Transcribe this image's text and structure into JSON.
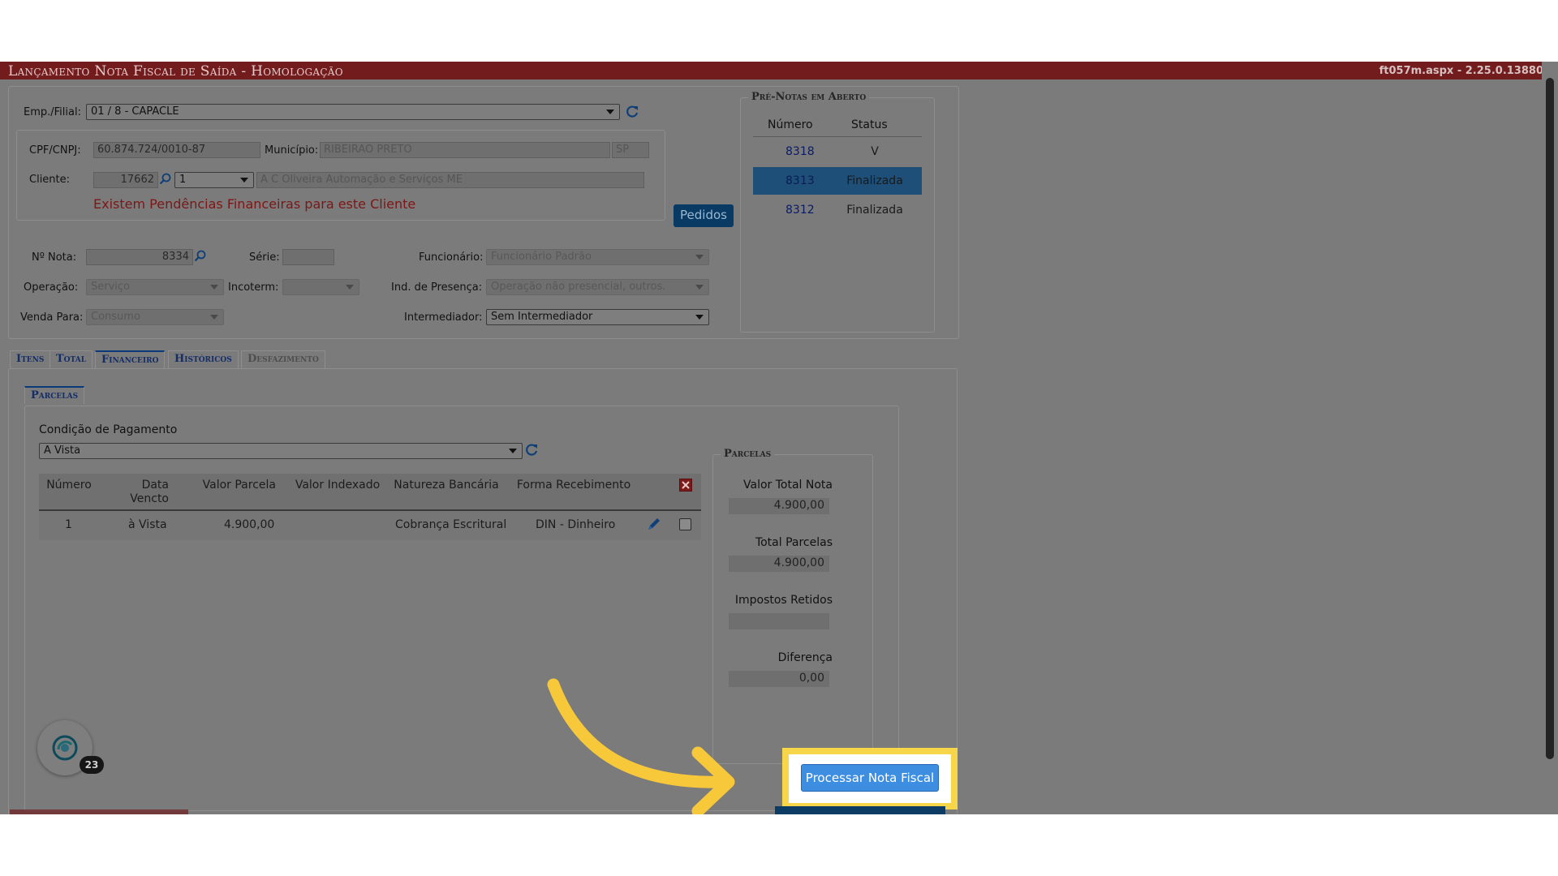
{
  "window": {
    "title": "Lançamento Nota Fiscal de Saída  - Homologação",
    "version": "ft057m.aspx - 2.25.0.13880"
  },
  "header": {
    "emp_label": "Emp./Filial:",
    "emp_value": "01 / 8 - CAPACLE",
    "cpf_label": "CPF/CNPJ:",
    "cpf_value": "60.874.724/0010-87",
    "municipio_label": "Município:",
    "municipio_value": "RIBEIRAO PRETO",
    "uf_value": "SP",
    "cliente_label": "Cliente:",
    "cliente_code": "17662",
    "cliente_seq": "1",
    "cliente_name": "A C Oliveira Automação e Serviços ME",
    "warning": "Existem Pendências Financeiras para este Cliente",
    "pedidos_button": "Pedidos"
  },
  "note": {
    "nota_label": "Nº Nota:",
    "nota_value": "8334",
    "serie_label": "Série:",
    "serie_value": "",
    "funcionario_label": "Funcionário:",
    "funcionario_value": "Funcionário Padrão",
    "operacao_label": "Operação:",
    "operacao_value": "Serviço",
    "incoterm_label": "Incoterm:",
    "incoterm_value": "",
    "presenca_label": "Ind. de Presença:",
    "presenca_value": "Operação não presencial, outros.",
    "venda_label": "Venda Para:",
    "venda_value": "Consumo",
    "intermediador_label": "Intermediador:",
    "intermediador_value": "Sem Intermediador"
  },
  "pre_notas": {
    "legend": "Pré-Notas em Aberto",
    "col_numero": "Número",
    "col_status": "Status",
    "rows": [
      {
        "numero": "8318",
        "status": "V"
      },
      {
        "numero": "8313",
        "status": "Finalizada"
      },
      {
        "numero": "8312",
        "status": "Finalizada"
      }
    ]
  },
  "tabs": [
    "Itens",
    "Total",
    "Financeiro",
    "Históricos",
    "Desfazimento"
  ],
  "financeiro": {
    "subtab": "Parcelas",
    "cond_label": "Condição de Pagamento",
    "cond_value": "A Vista",
    "columns": [
      "Número",
      "Data Vencto",
      "Valor Parcela",
      "Valor Indexado",
      "Natureza Bancária",
      "Forma Recebimento"
    ],
    "rows": [
      {
        "numero": "1",
        "vencto": "à Vista",
        "valor": "4.900,00",
        "indexado": "",
        "natureza": "Cobrança Escritural",
        "forma": "DIN - Dinheiro"
      }
    ]
  },
  "parcelas_summary": {
    "legend": "Parcelas",
    "valor_total_label": "Valor Total Nota",
    "valor_total": "4.900,00",
    "total_parcelas_label": "Total Parcelas",
    "total_parcelas": "4.900,00",
    "impostos_label": "Impostos Retidos",
    "impostos": "",
    "diferenca_label": "Diferença",
    "diferenca": "0,00"
  },
  "actions": {
    "processar": "Processar Nota Fiscal"
  },
  "chat_badge": "23",
  "colors": {
    "titlebar": "#731c1e",
    "highlight": "#f7d64a",
    "arrow": "#f7c83a",
    "button": "#3d8ee0"
  }
}
